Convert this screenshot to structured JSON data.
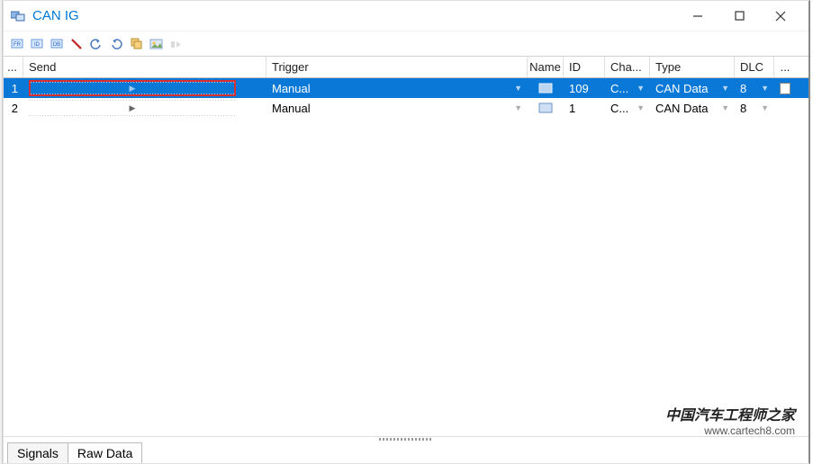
{
  "window": {
    "title": "CAN IG"
  },
  "header": {
    "more": "...",
    "send": "Send",
    "trigger": "Trigger",
    "name": "Name",
    "id": "ID",
    "chan": "Cha...",
    "type": "Type",
    "dlc": "DLC",
    "last": "..."
  },
  "rows": [
    {
      "n": "1",
      "trigger": "Manual",
      "id": "109",
      "chan": "C...",
      "type": "CAN Data",
      "dlc": "8",
      "selected": true
    },
    {
      "n": "2",
      "trigger": "Manual",
      "id": "1",
      "chan": "C...",
      "type": "CAN Data",
      "dlc": "8",
      "selected": false
    }
  ],
  "tabs": {
    "signals": "Signals",
    "raw": "Raw Data"
  },
  "watermark": {
    "cn": "中国汽车工程师之家",
    "en": "www.cartech8.com"
  }
}
